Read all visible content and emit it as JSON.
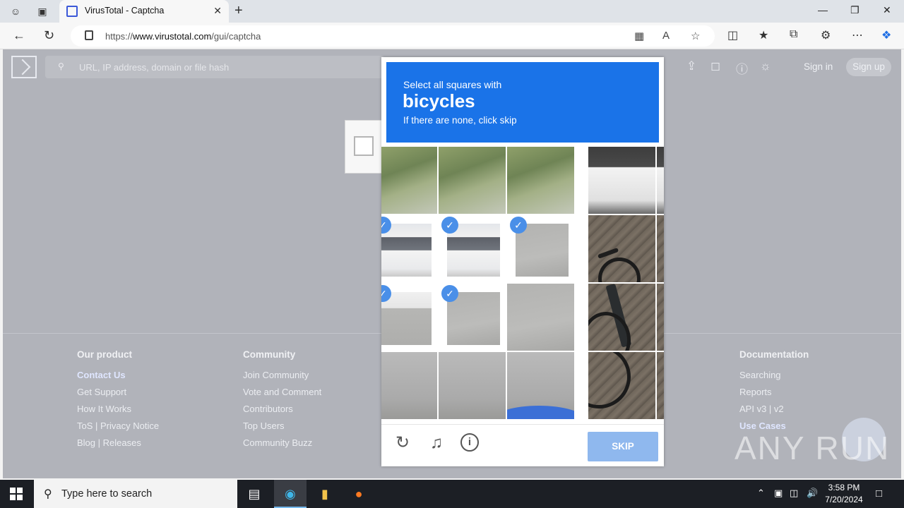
{
  "browser": {
    "tab_title": "VirusTotal - Captcha",
    "url_prefix": "https://",
    "url_domain": "www.virustotal.com",
    "url_path": "/gui/captcha"
  },
  "header": {
    "search_placeholder": "URL, IP address, domain or file hash",
    "sign_in": "Sign in",
    "sign_up": "Sign up"
  },
  "captcha": {
    "prompt_line1": "Select all squares with",
    "prompt_target": "bicycles",
    "prompt_line3": "If there are none, click skip",
    "skip_label": "SKIP",
    "selected_tiles": [
      3,
      4,
      5,
      6,
      7
    ]
  },
  "footer": {
    "columns": [
      {
        "heading": "Our product",
        "links": [
          "Contact Us",
          "Get Support",
          "How It Works",
          "ToS | Privacy Notice",
          "Blog | Releases"
        ]
      },
      {
        "heading": "Community",
        "links": [
          "Join Community",
          "Vote and Comment",
          "Contributors",
          "Top Users",
          "Community Buzz"
        ]
      },
      {
        "heading": "Documentation",
        "links": [
          "Searching",
          "Reports",
          "API v3 | v2",
          "Use Cases"
        ]
      }
    ]
  },
  "watermark": "ANY RUN",
  "taskbar": {
    "search_placeholder": "Type here to search",
    "time": "3:58 PM",
    "date": "7/20/2024"
  },
  "colors": {
    "prompt_bg": "#1a73e8",
    "skip_bg": "#8fb8ee",
    "check": "#4a8fe8",
    "page_overlay": "#b1b3ba"
  }
}
